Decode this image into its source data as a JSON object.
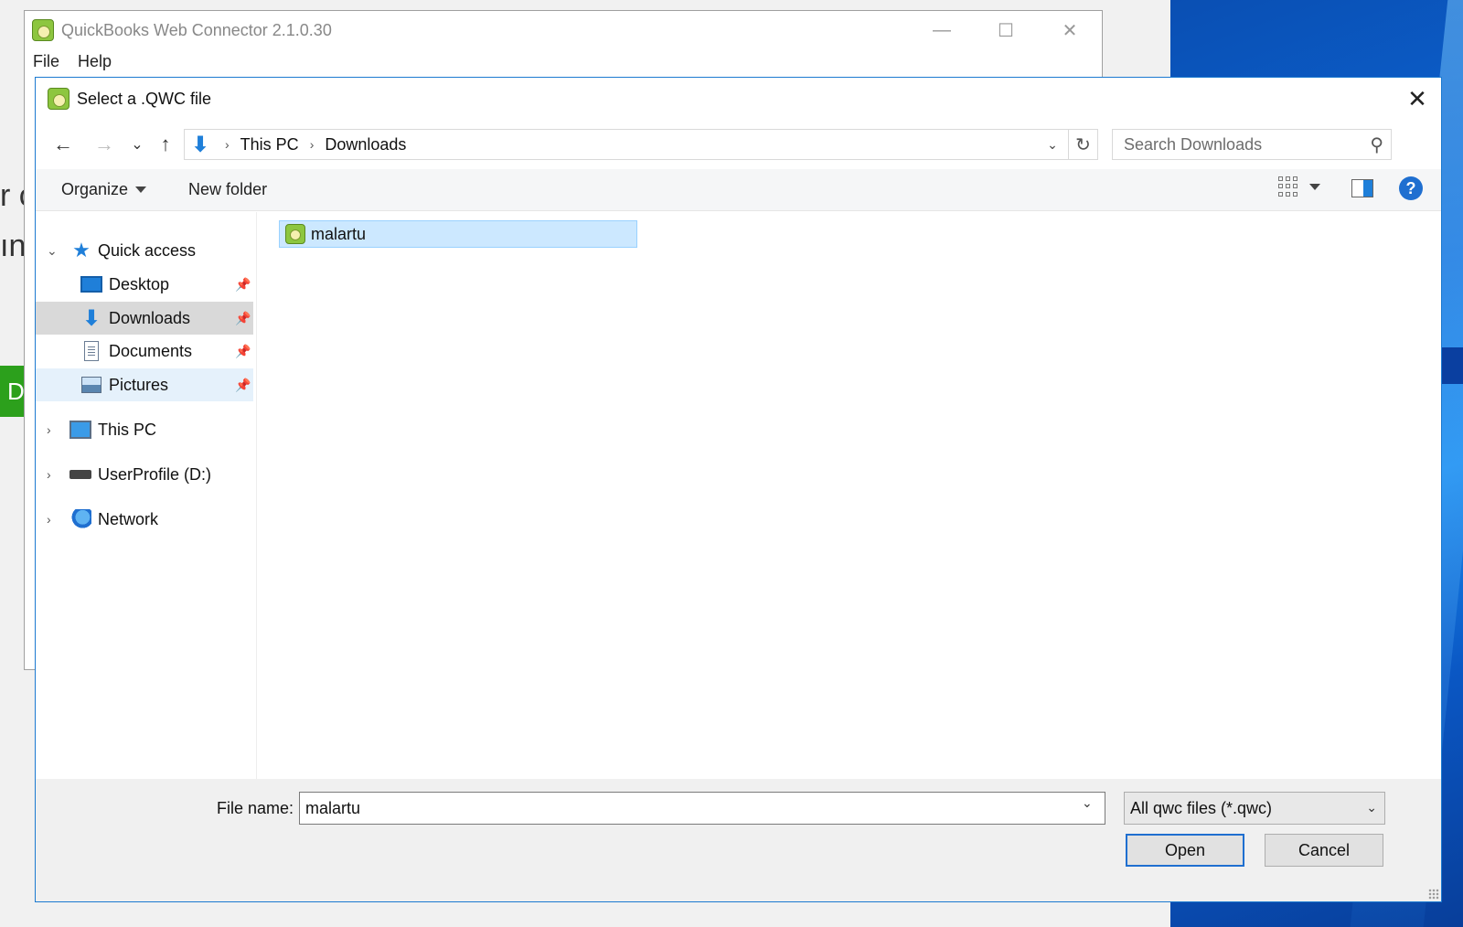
{
  "background": {
    "text_line1": "r c",
    "text_line2": "ın",
    "green_button_text": "D"
  },
  "qb_window": {
    "title": "QuickBooks Web Connector 2.1.0.30",
    "menu": [
      "File",
      "Help"
    ],
    "controls": {
      "minimize": "—",
      "maximize": "☐",
      "close": "✕"
    }
  },
  "dialog": {
    "title": "Select a .QWC file",
    "close_glyph": "✕",
    "nav": {
      "back": "←",
      "forward": "→",
      "recent": "⌄",
      "up": "↑"
    },
    "address": {
      "crumbs": [
        "This PC",
        "Downloads"
      ],
      "separator": "›",
      "dropdown": "⌄",
      "refresh": "↻"
    },
    "search": {
      "placeholder": "Search Downloads",
      "icon": "⚲"
    },
    "toolbar": {
      "organize": "Organize",
      "new_folder": "New folder",
      "help": "?"
    },
    "nav_pane": {
      "quick_access": "Quick access",
      "quick_items": [
        {
          "label": "Desktop",
          "icon": "desktop-icon",
          "pinned": true
        },
        {
          "label": "Downloads",
          "icon": "downloads-icon",
          "pinned": true
        },
        {
          "label": "Documents",
          "icon": "documents-icon",
          "pinned": true
        },
        {
          "label": "Pictures",
          "icon": "pictures-icon",
          "pinned": true
        }
      ],
      "this_pc": "This PC",
      "user_profile": "UserProfile (D:)",
      "network": "Network",
      "expand_open": "⌄",
      "expand_closed": "›",
      "pin_glyph": "📌"
    },
    "files": [
      {
        "name": "malartu",
        "icon": "qwc-file-icon",
        "selected": true
      }
    ],
    "bottom": {
      "file_name_label": "File name:",
      "file_name_value": "malartu",
      "filter": "All qwc files (*.qwc)",
      "open": "Open",
      "cancel": "Cancel"
    }
  },
  "colors": {
    "accent": "#1f6fd0",
    "selection": "#cce8ff",
    "qb_green": "#8dc63f"
  }
}
